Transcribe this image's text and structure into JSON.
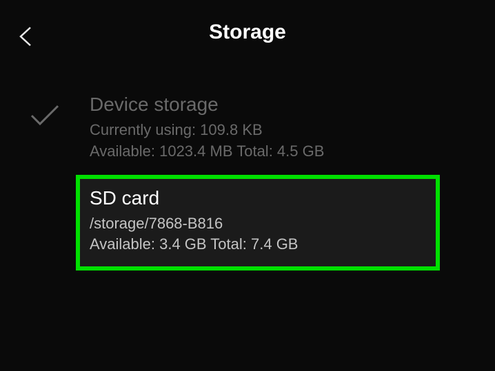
{
  "header": {
    "title": "Storage"
  },
  "options": {
    "device": {
      "title": "Device storage",
      "using": "Currently using: 109.8 KB",
      "available": "Available: 1023.4 MB Total: 4.5 GB"
    },
    "sdcard": {
      "title": "SD card",
      "path": "/storage/7868-B816",
      "available": "Available: 3.4 GB Total: 7.4 GB"
    }
  }
}
